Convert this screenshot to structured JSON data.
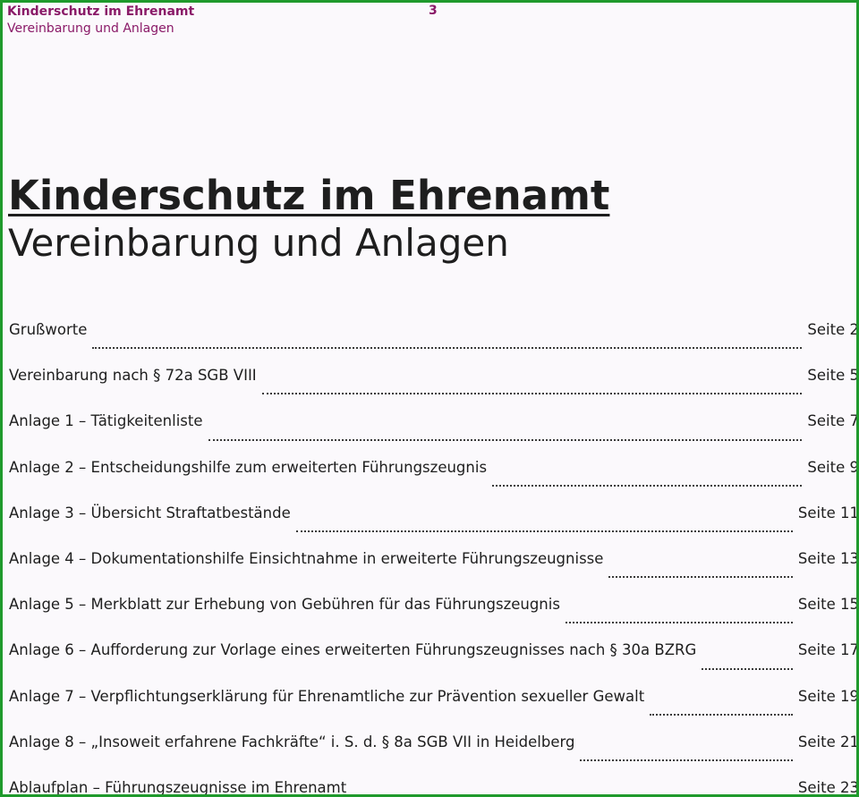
{
  "header": {
    "title": "Kinderschutz im Ehrenamt",
    "subtitle": "Vereinbarung und Anlagen",
    "page_number": "3"
  },
  "document": {
    "title": "Kinderschutz im Ehrenamt",
    "subtitle": "Vereinbarung und Anlagen"
  },
  "toc": [
    {
      "label": "Grußworte",
      "page": "Seite 2"
    },
    {
      "label": "Vereinbarung nach § 72a SGB VIII",
      "page": "Seite 5"
    },
    {
      "label": "Anlage 1 – Tätigkeitenliste",
      "page": "Seite 7"
    },
    {
      "label": "Anlage 2 – Entscheidungshilfe zum erweiterten Führungszeugnis",
      "page": "Seite 9"
    },
    {
      "label": "Anlage 3 – Übersicht Straftatbestände",
      "page": "Seite 11"
    },
    {
      "label": "Anlage 4 – Dokumentationshilfe Einsichtnahme in erweiterte Führungszeugnisse",
      "page": "Seite 13"
    },
    {
      "label": "Anlage 5 – Merkblatt zur Erhebung von Gebühren für das Führungszeugnis",
      "page": "Seite 15"
    },
    {
      "label": "Anlage 6 – Aufforderung zur Vorlage eines erweiterten Führungszeugnisses nach § 30a BZRG",
      "page": "Seite 17"
    },
    {
      "label": "Anlage 7 – Verpflichtungserklärung für Ehrenamtliche zur Prävention sexueller Gewalt",
      "page": "Seite 19"
    },
    {
      "label": "Anlage 8 – „Insoweit erfahrene Fachkräfte“ i. S. d. § 8a SGB VII in Heidelberg",
      "page": "Seite 21"
    },
    {
      "label": "Ablaufplan – Führungszeugnisse im Ehrenamt",
      "page": "Seite 23"
    }
  ]
}
